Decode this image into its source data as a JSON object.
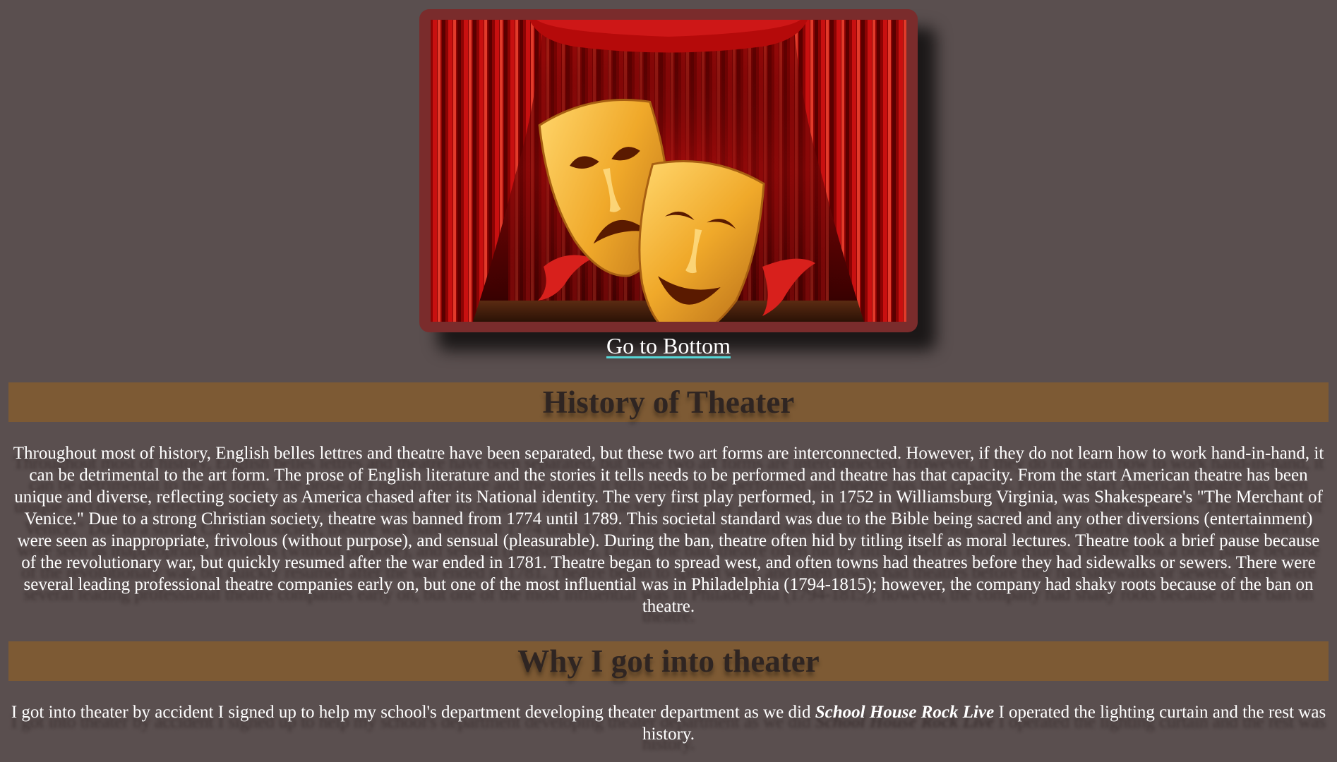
{
  "nav": {
    "go_to_bottom": "Go to Bottom"
  },
  "hero": {
    "image_subject": "theater-masks-red-curtain"
  },
  "sections": [
    {
      "heading": "History of Theater",
      "text": "Throughout most of history, English belles lettres and theatre have been separated, but these two art forms are interconnected. However, if they do not learn how to work hand-in-hand, it can be detrimental to the art form. The prose of English literature and the stories it tells needs to be performed and theatre has that capacity. From the start American theatre has been unique and diverse, reflecting society as America chased after its National identity. The very first play performed, in 1752 in Williamsburg Virginia, was Shakespeare's \"The Merchant of Venice.\" Due to a strong Christian society, theatre was banned from 1774 until 1789. This societal standard was due to the Bible being sacred and any other diversions (entertainment) were seen as inappropriate, frivolous (without purpose), and sensual (pleasurable). During the ban, theatre often hid by titling itself as moral lectures. Theatre took a brief pause because of the revolutionary war, but quickly resumed after the war ended in 1781. Theatre began to spread west, and often towns had theatres before they had sidewalks or sewers. There were several leading professional theatre companies early on, but one of the most influential was in Philadelphia (1794-1815); however, the company had shaky roots because of the ban on theatre."
    },
    {
      "heading": "Why I got into theater",
      "text_before": "I got into theater by accident I signed up to help my school's department developing theater department as we did ",
      "text_emphasis": "School House Rock Live",
      "text_after": " I operated the lighting curtain and the rest was history."
    }
  ],
  "colors": {
    "background": "#5a4f4f",
    "frame": "#7a2c2c",
    "heading_bar": "#7d5a34",
    "heading_text": "#2f2522",
    "link_underline": "#56d6d6"
  }
}
